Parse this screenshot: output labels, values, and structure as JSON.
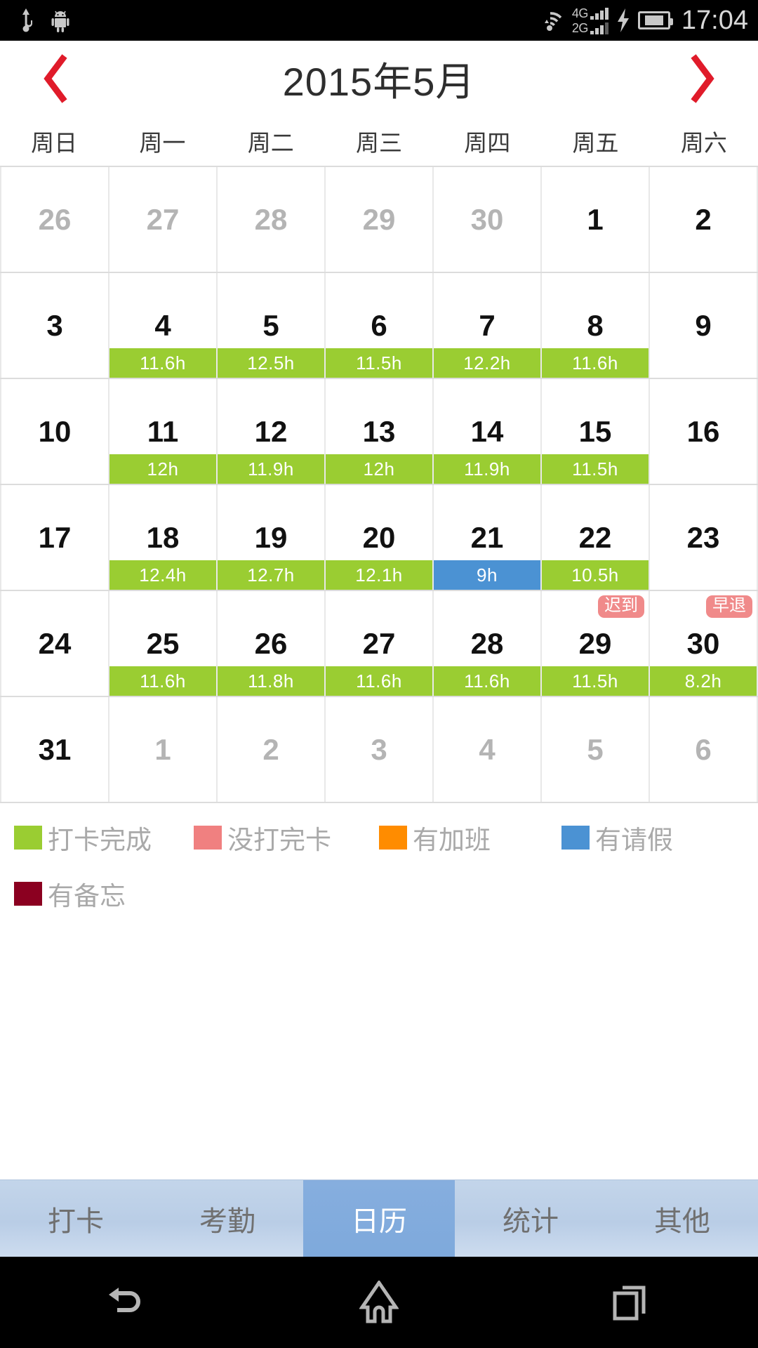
{
  "status_bar": {
    "usb_icon": "usb-icon",
    "android_icon": "android-robot-icon",
    "wifi_icon": "wifi-icon",
    "net_primary": "4G",
    "net_secondary": "2G",
    "charging_icon": "charging-bolt-icon",
    "battery_icon": "battery-icon",
    "time": "17:04"
  },
  "header": {
    "prev_label": "chevron-left-icon",
    "next_label": "chevron-right-icon",
    "title": "2015年5月",
    "arrow_color": "#e01b2a"
  },
  "weekdays": [
    "周日",
    "周一",
    "周二",
    "周三",
    "周四",
    "周五",
    "周六"
  ],
  "calendar": {
    "weeks": [
      [
        {
          "day": "26",
          "current": false
        },
        {
          "day": "27",
          "current": false
        },
        {
          "day": "28",
          "current": false
        },
        {
          "day": "29",
          "current": false
        },
        {
          "day": "30",
          "current": false
        },
        {
          "day": "1",
          "current": true
        },
        {
          "day": "2",
          "current": true
        }
      ],
      [
        {
          "day": "3",
          "current": true
        },
        {
          "day": "4",
          "current": true,
          "hours": "11.6h",
          "state": "done"
        },
        {
          "day": "5",
          "current": true,
          "hours": "12.5h",
          "state": "done"
        },
        {
          "day": "6",
          "current": true,
          "hours": "11.5h",
          "state": "done"
        },
        {
          "day": "7",
          "current": true,
          "hours": "12.2h",
          "state": "done"
        },
        {
          "day": "8",
          "current": true,
          "hours": "11.6h",
          "state": "done"
        },
        {
          "day": "9",
          "current": true
        }
      ],
      [
        {
          "day": "10",
          "current": true
        },
        {
          "day": "11",
          "current": true,
          "hours": "12h",
          "state": "done"
        },
        {
          "day": "12",
          "current": true,
          "hours": "11.9h",
          "state": "done"
        },
        {
          "day": "13",
          "current": true,
          "hours": "12h",
          "state": "done"
        },
        {
          "day": "14",
          "current": true,
          "hours": "11.9h",
          "state": "done"
        },
        {
          "day": "15",
          "current": true,
          "hours": "11.5h",
          "state": "done"
        },
        {
          "day": "16",
          "current": true
        }
      ],
      [
        {
          "day": "17",
          "current": true
        },
        {
          "day": "18",
          "current": true,
          "hours": "12.4h",
          "state": "done"
        },
        {
          "day": "19",
          "current": true,
          "hours": "12.7h",
          "state": "done"
        },
        {
          "day": "20",
          "current": true,
          "hours": "12.1h",
          "state": "done"
        },
        {
          "day": "21",
          "current": true,
          "hours": "9h",
          "state": "leave"
        },
        {
          "day": "22",
          "current": true,
          "hours": "10.5h",
          "state": "done"
        },
        {
          "day": "23",
          "current": true
        }
      ],
      [
        {
          "day": "24",
          "current": true
        },
        {
          "day": "25",
          "current": true,
          "hours": "11.6h",
          "state": "done"
        },
        {
          "day": "26",
          "current": true,
          "hours": "11.8h",
          "state": "done"
        },
        {
          "day": "27",
          "current": true,
          "hours": "11.6h",
          "state": "done"
        },
        {
          "day": "28",
          "current": true,
          "hours": "11.6h",
          "state": "done"
        },
        {
          "day": "29",
          "current": true,
          "hours": "11.5h",
          "state": "done",
          "tag": "迟到"
        },
        {
          "day": "30",
          "current": true,
          "hours": "8.2h",
          "state": "done",
          "tag": "早退"
        }
      ],
      [
        {
          "day": "31",
          "current": true
        },
        {
          "day": "1",
          "current": false
        },
        {
          "day": "2",
          "current": false
        },
        {
          "day": "3",
          "current": false
        },
        {
          "day": "4",
          "current": false
        },
        {
          "day": "5",
          "current": false
        },
        {
          "day": "6",
          "current": false
        }
      ]
    ]
  },
  "legend": {
    "rows": [
      [
        {
          "label": "打卡完成",
          "color": "#9acd32"
        },
        {
          "label": "没打完卡",
          "color": "#f08080"
        },
        {
          "label": "有加班",
          "color": "#ff8c00"
        },
        {
          "label": "有请假",
          "color": "#4b92d3"
        }
      ],
      [
        {
          "label": "有备忘",
          "color": "#8b0020"
        }
      ]
    ]
  },
  "tabs": [
    {
      "label": "打卡",
      "active": false
    },
    {
      "label": "考勤",
      "active": false
    },
    {
      "label": "日历",
      "active": true
    },
    {
      "label": "统计",
      "active": false
    },
    {
      "label": "其他",
      "active": false
    }
  ],
  "nav_bar": {
    "back": "back-icon",
    "home": "home-icon",
    "recents": "recents-icon"
  }
}
